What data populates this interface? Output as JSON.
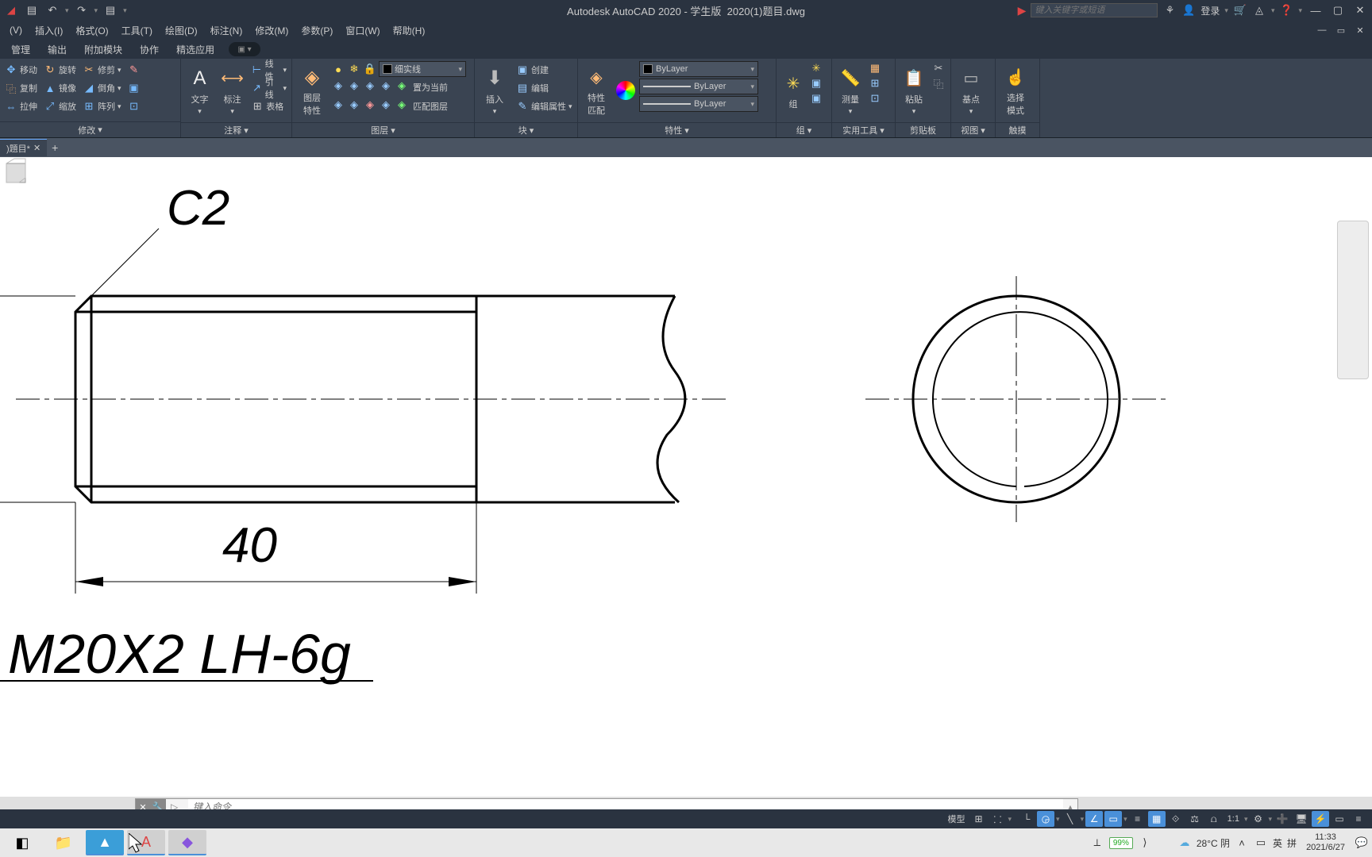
{
  "title": {
    "app": "Autodesk AutoCAD 2020 - 学生版",
    "file": "2020(1)题目.dwg"
  },
  "search": {
    "placeholder": "键入关键字或短语"
  },
  "login": "登录",
  "menubar": [
    "(V)",
    "插入(I)",
    "格式(O)",
    "工具(T)",
    "绘图(D)",
    "标注(N)",
    "修改(M)",
    "参数(P)",
    "窗口(W)",
    "帮助(H)"
  ],
  "tabs": [
    "管理",
    "输出",
    "附加模块",
    "协作",
    "精选应用"
  ],
  "modify": {
    "move": "移动",
    "rotate": "旋转",
    "trim": "修剪",
    "copy": "复制",
    "mirror": "镜像",
    "fillet": "倒角",
    "stretch": "拉伸",
    "scale": "缩放",
    "array": "阵列",
    "title": "修改"
  },
  "annot": {
    "text": "文字",
    "dim": "标注",
    "table": "表格",
    "title": "注释"
  },
  "draw": {
    "line": "线性",
    "lead": "引线",
    "title": ""
  },
  "layer": {
    "big": "图层\n特性",
    "current": "细实线",
    "setcurrent": "置为当前",
    "match": "匹配图层",
    "title": "图层"
  },
  "block": {
    "insert": "插入",
    "create": "创建",
    "edit": "编辑",
    "editattr": "编辑属性",
    "title": "块"
  },
  "props": {
    "big": "特性\n匹配",
    "bylayer": "ByLayer",
    "title": "特性"
  },
  "group": {
    "big": "组",
    "title": "组"
  },
  "util": {
    "measure": "测量",
    "title": "实用工具"
  },
  "clip": {
    "paste": "粘贴",
    "title": "剪贴板"
  },
  "view": {
    "base": "基点",
    "title": "视图"
  },
  "touch": {
    "select": "选择\n模式",
    "title": "触摸"
  },
  "filetab": {
    "name": ")題目*"
  },
  "drawing": {
    "c2": "C2",
    "dim40": "40",
    "thread": "M20X2 LH-6g"
  },
  "cmd": {
    "placeholder": "键入命令"
  },
  "status": {
    "model": "模型",
    "scale": "1:1"
  },
  "tray": {
    "battery": "99%",
    "temp": "28°C 阴",
    "ime1": "英",
    "ime2": "拼",
    "time": "11:33",
    "date": "2021/6/27"
  }
}
